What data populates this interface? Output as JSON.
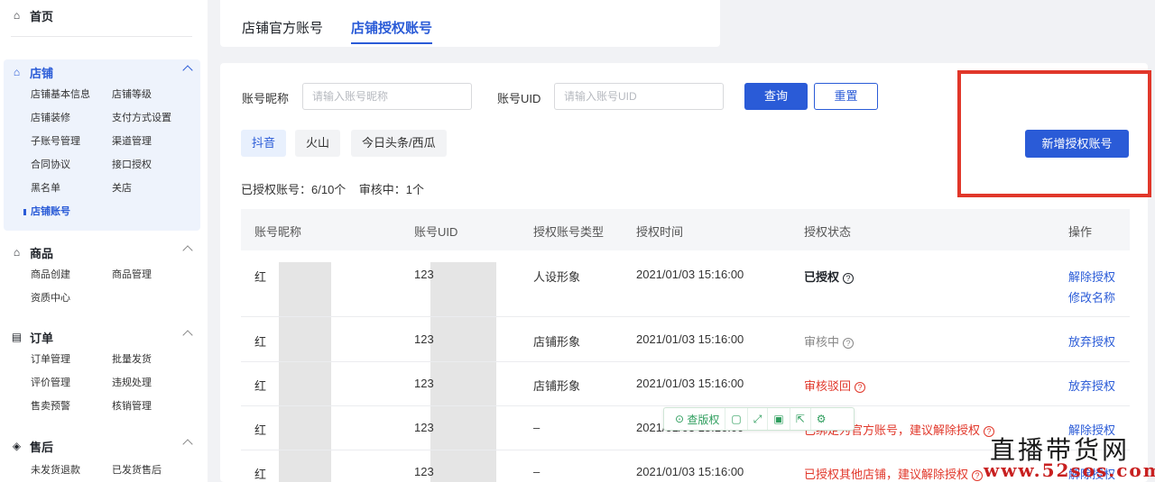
{
  "sidebar": {
    "home": "首页",
    "sections": [
      {
        "title": "店铺",
        "items": [
          "店铺基本信息",
          "店铺等级",
          "店铺装修",
          "支付方式设置",
          "子账号管理",
          "渠道管理",
          "合同协议",
          "接口授权",
          "黑名单",
          "关店",
          "店铺账号"
        ]
      },
      {
        "title": "商品",
        "items": [
          "商品创建",
          "商品管理",
          "资质中心"
        ]
      },
      {
        "title": "订单",
        "items": [
          "订单管理",
          "批量发货",
          "评价管理",
          "违规处理",
          "售卖预警",
          "核销管理"
        ]
      },
      {
        "title": "售后",
        "items": [
          "未发货退款",
          "已发货售后"
        ]
      }
    ]
  },
  "tabs": [
    "店铺官方账号",
    "店铺授权账号"
  ],
  "filters": {
    "nickname_label": "账号昵称",
    "nickname_placeholder": "请输入账号昵称",
    "uid_label": "账号UID",
    "uid_placeholder": "请输入账号UID",
    "search_btn": "查询",
    "reset_btn": "重置"
  },
  "platforms": [
    "抖音",
    "火山",
    "今日头条/西瓜"
  ],
  "add_btn": "新增授权账号",
  "summary": "已授权账号：6/10个    审核中：1个",
  "table": {
    "headers": [
      "账号昵称",
      "账号UID",
      "授权账号类型",
      "授权时间",
      "授权状态",
      "操作"
    ],
    "rows": [
      {
        "name": "红",
        "uid": "123",
        "type": "人设形象",
        "time": "2021/01/03 15:16:00",
        "status": "已授权",
        "ops": [
          "解除授权",
          "修改名称"
        ]
      },
      {
        "name": "红",
        "uid": "123",
        "type": "店铺形象",
        "time": "2021/01/03 15:16:00",
        "status": "审核中",
        "ops": [
          "放弃授权"
        ]
      },
      {
        "name": "红",
        "uid": "123",
        "type": "店铺形象",
        "time": "2021/01/03 15:16:00",
        "status": "审核驳回",
        "ops": [
          "放弃授权"
        ]
      },
      {
        "name": "红",
        "uid": "123",
        "type": "–",
        "time": "2021/01/03 15:16:00",
        "status": "已绑定为官方账号，建议解除授权",
        "ops": [
          "解除授权"
        ]
      },
      {
        "name": "红",
        "uid": "123",
        "type": "–",
        "time": "2021/01/03 15:16:00",
        "status": "已授权其他店铺，建议解除授权",
        "ops": [
          "解除授权"
        ]
      }
    ]
  },
  "float_toolbar": {
    "label": "查版权"
  },
  "watermark": {
    "line1": "直播带货网",
    "line2": "www.52sos.com"
  },
  "colors": {
    "primary": "#2a5bd7",
    "danger": "#e1372a"
  }
}
